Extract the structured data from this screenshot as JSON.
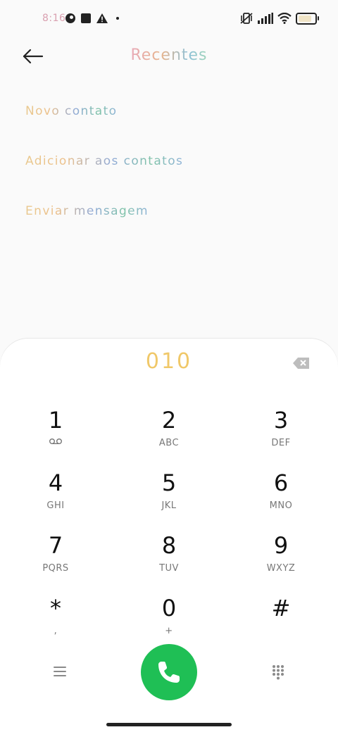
{
  "status_bar": {
    "time": "8:16",
    "left_icons": [
      "app-notification-icon",
      "square-notification-icon",
      "warning-icon",
      "more-dot-icon"
    ],
    "right_icons": [
      "vibrate-off-icon",
      "signal-icon",
      "wifi-icon",
      "battery-icon"
    ]
  },
  "header": {
    "title": "Recentes",
    "back_icon": "back-arrow-icon"
  },
  "actions": [
    {
      "label": "Novo contato"
    },
    {
      "label": "Adicionar aos contatos"
    },
    {
      "label": "Enviar mensagem"
    }
  ],
  "dialer": {
    "number": "010",
    "backspace_icon": "backspace-icon",
    "keys": [
      {
        "digit": "1",
        "sub": "",
        "sub_icon": "voicemail-icon"
      },
      {
        "digit": "2",
        "sub": "ABC"
      },
      {
        "digit": "3",
        "sub": "DEF"
      },
      {
        "digit": "4",
        "sub": "GHI"
      },
      {
        "digit": "5",
        "sub": "JKL"
      },
      {
        "digit": "6",
        "sub": "MNO"
      },
      {
        "digit": "7",
        "sub": "PQRS"
      },
      {
        "digit": "8",
        "sub": "TUV"
      },
      {
        "digit": "9",
        "sub": "WXYZ"
      },
      {
        "digit": "*",
        "sub": ","
      },
      {
        "digit": "0",
        "sub": "+"
      },
      {
        "digit": "#",
        "sub": ""
      }
    ]
  },
  "bottom_bar": {
    "menu_icon": "menu-icon",
    "call_icon": "phone-icon",
    "call_color": "#1fbf55",
    "dialpad_icon": "dialpad-icon"
  },
  "colors": {
    "number_color": "#f0c869",
    "background": "#fafafa"
  }
}
